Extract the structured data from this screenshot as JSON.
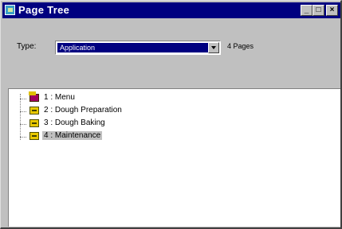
{
  "window": {
    "title": "Page Tree",
    "title_buttons": {
      "minimize": "_",
      "maximize": "□",
      "close": "×"
    }
  },
  "toolbar": {
    "type_label": "Type:",
    "type_value": "Application",
    "pages_count": "4 Pages"
  },
  "tree": {
    "items": [
      {
        "label": "1 : Menu",
        "icon": "menu-folder-icon",
        "selected": false
      },
      {
        "label": "2 : Dough Preparation",
        "icon": "page-icon",
        "selected": false
      },
      {
        "label": "3 : Dough Baking",
        "icon": "page-icon",
        "selected": false
      },
      {
        "label": "4 : Maintenance",
        "icon": "page-icon",
        "selected": true
      }
    ]
  },
  "colors": {
    "titlebar": "#000080",
    "selection": "#000080",
    "window_face": "#c0c0c0"
  }
}
